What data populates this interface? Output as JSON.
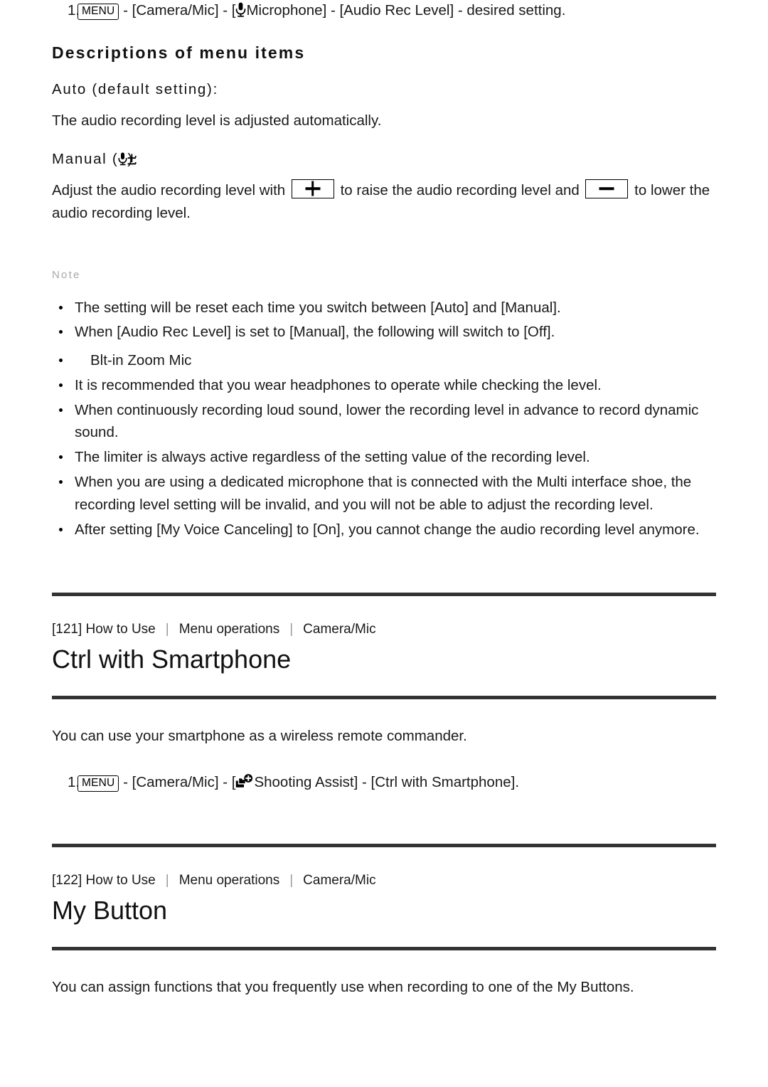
{
  "article_audio_rec_level": {
    "step1": {
      "number": "1.",
      "menu_key_label": "MENU",
      "text_before_mic": " - [Camera/Mic] - [",
      "mic_label": "Microphone] - [Audio Rec Level] - desired setting."
    },
    "descriptions_heading": "Descriptions of menu items",
    "auto_heading": "Auto (default setting):",
    "auto_text": "The audio recording level is adjusted automatically.",
    "manual_heading_prefix": "Manual (",
    "manual_heading_suffix": "):",
    "manual_text_part1": "Adjust the audio recording level with ",
    "manual_text_part2": " to raise the audio recording level and ",
    "manual_text_part3": " to lower the audio recording level.",
    "note_label": "Note",
    "notes": [
      "The setting will be reset each time you switch between [Auto] and [Manual].",
      "When [Audio Rec Level] is set to [Manual], the following will switch to [Off].",
      "It is recommended that you wear headphones to operate while checking the level.",
      "When continuously recording loud sound, lower the recording level in advance to record dynamic sound.",
      "The limiter is always active regardless of the setting value of the recording level.",
      "When you are using a dedicated microphone that is connected with the Multi interface shoe, the recording level setting will be invalid, and you will not be able to adjust the recording level.",
      "After setting [My Voice Canceling] to [On], you cannot change the audio recording level anymore."
    ],
    "note_subitem": "Blt-in Zoom Mic"
  },
  "article_ctrl_with_smartphone": {
    "breadcrumb": {
      "index": "[121] How to Use",
      "separator": "|",
      "level2": "Menu operations",
      "level3": "Camera/Mic"
    },
    "title": "Ctrl with Smartphone",
    "intro": "You can use your smartphone as a wireless remote commander.",
    "step1": {
      "number": "1.",
      "menu_key_label": "MENU",
      "text_before_icon": " - [Camera/Mic] - [",
      "text_after_icon": "Shooting Assist] - [Ctrl with Smartphone]."
    }
  },
  "article_my_button": {
    "breadcrumb": {
      "index": "[122] How to Use",
      "separator": "|",
      "level2": "Menu operations",
      "level3": "Camera/Mic"
    },
    "title": "My Button",
    "intro": "You can assign functions that you frequently use when recording to one of the My Buttons."
  },
  "colors": {
    "text": "#1a1a1a",
    "rule": "#333333",
    "note_label": "#a8a8a8",
    "crumb_separator": "#9a9a9a"
  },
  "icons": {
    "menu_key": "menu-key-icon",
    "microphone": "microphone-icon",
    "mic_plus_minus": "mic-plus-minus-icon",
    "plus_key": "plus-key-icon",
    "minus_key": "minus-key-icon",
    "shooting_assist": "shooting-assist-icon"
  }
}
